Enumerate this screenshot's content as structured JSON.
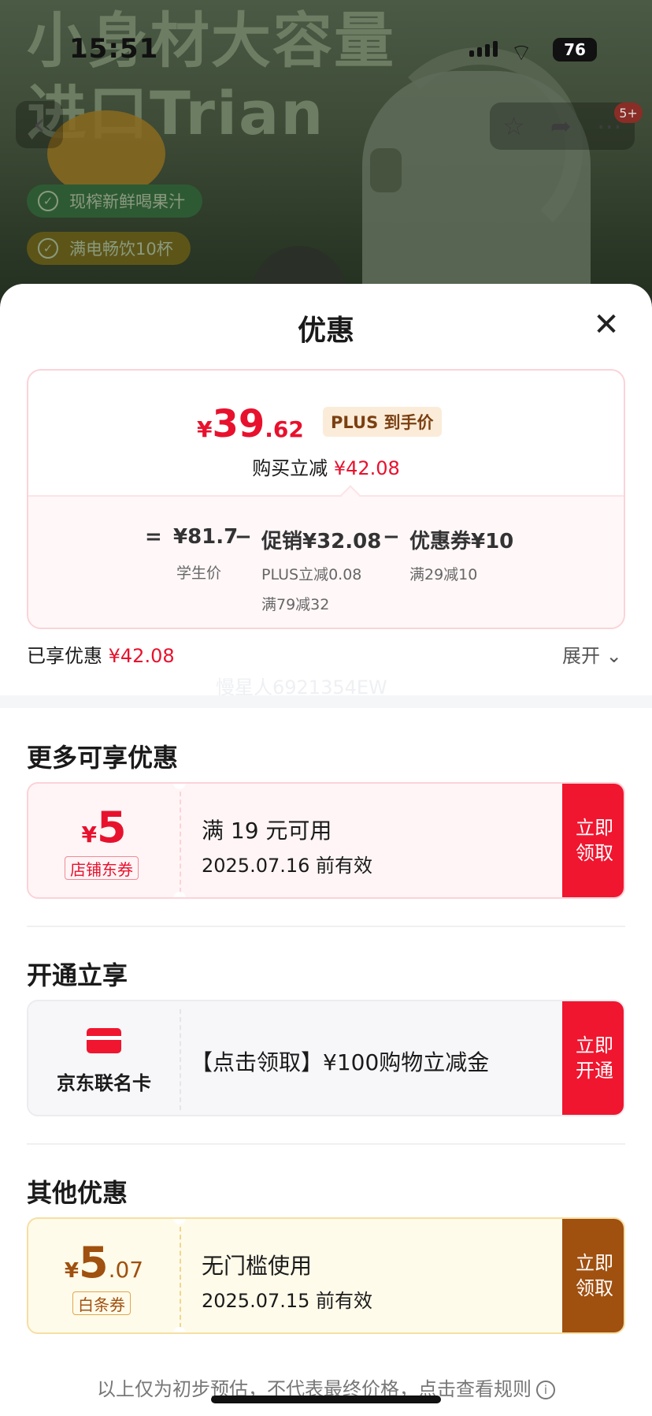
{
  "status": {
    "time": "15:51",
    "battery": "76"
  },
  "background": {
    "headline_line1": "小身材大容量",
    "headline_line2": "进口Trian",
    "pill1": "现榨新鲜喝果汁",
    "pill2": "满电畅饮10杯",
    "message_badge": "5+"
  },
  "sheet": {
    "title": "优惠"
  },
  "price": {
    "currency": "¥",
    "integer": "39",
    "decimal": ".62",
    "plus_tag": "PLUS 到手价",
    "instant_label": "购买立减",
    "instant_value": "¥42.08",
    "equals": "=",
    "base_value": "¥81.7",
    "base_label": "学生价",
    "minus": "−",
    "promo_value": "促销¥32.08",
    "promo_detail1": "PLUS立减0.08",
    "promo_detail2": "满79减32",
    "coupon_value": "优惠券¥10",
    "coupon_detail": "满29减10"
  },
  "enjoyed": {
    "label": "已享优惠",
    "value": "¥42.08",
    "expand": "展开"
  },
  "watermark": "慢星人6921354EW",
  "sections": {
    "more_title": "更多可享优惠",
    "open_title": "开通立享",
    "other_title": "其他优惠"
  },
  "coupon1": {
    "currency": "¥",
    "amount": "5",
    "type": "店铺东券",
    "condition": "满 19 元可用",
    "expiry": "2025.07.16 前有效",
    "button": "立即领取"
  },
  "coupon2": {
    "card_name": "京东联名卡",
    "text": "【点击领取】¥100购物立减金",
    "button": "立即开通"
  },
  "coupon3": {
    "currency": "¥",
    "amount": "5",
    "decimal": ".07",
    "type": "白条券",
    "condition": "无门槛使用",
    "expiry": "2025.07.15 前有效",
    "button": "立即领取"
  },
  "footer": {
    "note": "以上仅为初步预估，不代表最终价格，点击查看规则"
  },
  "colors": {
    "accent_red": "#e8112d",
    "button_red": "#f0162f",
    "baitiao_brown": "#a0500f"
  }
}
